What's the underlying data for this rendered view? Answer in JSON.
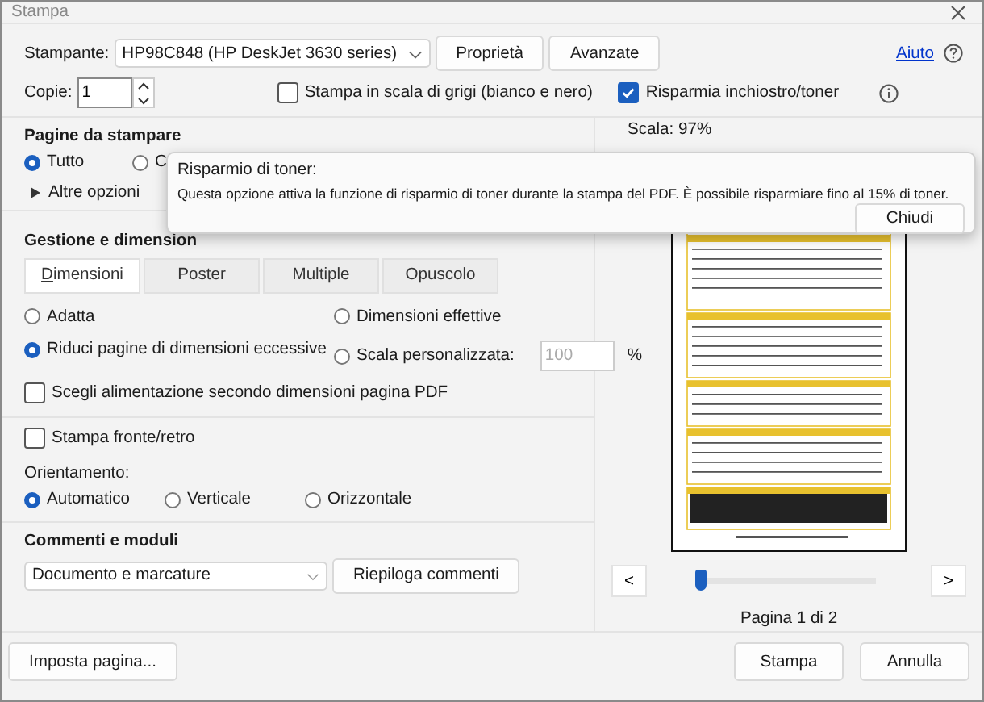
{
  "window": {
    "title": "Stampa"
  },
  "printer": {
    "label": "Stampante:",
    "value": "HP98C848 (HP DeskJet 3630 series)",
    "buttons": [
      "Proprietà",
      "Avanzate"
    ],
    "help_link": "Aiuto"
  },
  "copies": {
    "label": "Copie:",
    "value": "1"
  },
  "options": [
    {
      "label": "Stampa in scala di grigi (bianco e nero)",
      "checked": false
    },
    {
      "label": "Risparmia inchiostro/toner",
      "checked": true
    }
  ],
  "pages": {
    "title": "Pagine da stampare",
    "radios": [
      {
        "label": "Tutto",
        "selected": true
      },
      {
        "label": "C",
        "selected": false
      }
    ],
    "more": "Altre opzioni"
  },
  "sizing": {
    "title": "Gestione e dimension",
    "tabs": [
      {
        "label": "Dimensioni",
        "selected": true
      },
      {
        "label": "Poster",
        "selected": false
      },
      {
        "label": "Multiple",
        "selected": false
      },
      {
        "label": "Opuscolo",
        "selected": false
      }
    ],
    "radios": [
      {
        "label": "Adatta",
        "selected": false
      },
      {
        "label": "Dimensioni effettive",
        "selected": false
      },
      {
        "label": "Riduci pagine di dimensioni eccessive",
        "selected": true
      },
      {
        "label": "Scala personalizzata:",
        "selected": false
      }
    ],
    "scale_value": "100",
    "scale_unit": "%",
    "paper_source": {
      "label": "Scegli alimentazione secondo dimensioni pagina PDF",
      "checked": false
    }
  },
  "duplex": {
    "label": "Stampa fronte/retro",
    "checked": false
  },
  "orientation": {
    "label": "Orientamento:",
    "radios": [
      {
        "label": "Automatico",
        "selected": true
      },
      {
        "label": "Verticale",
        "selected": false
      },
      {
        "label": "Orizzontale",
        "selected": false
      }
    ]
  },
  "comments": {
    "title": "Commenti e moduli",
    "value": "Documento e marcature",
    "button": "Riepiloga commenti"
  },
  "preview": {
    "scale_label": "Scala:",
    "scale_value": "97%",
    "page_label": "Pagina 1 di 2",
    "prev": "<",
    "next": ">",
    "slider": {
      "level": 0
    }
  },
  "footer": {
    "setup": "Imposta pagina...",
    "buttons": [
      "Stampa",
      "Annulla"
    ]
  },
  "popup": {
    "title": "Risparmio di toner:",
    "message": "Questa opzione attiva la funzione di risparmio di toner durante la stampa del PDF. È possibile risparmiare fino al 15% di toner.",
    "button": "Chiudi"
  }
}
